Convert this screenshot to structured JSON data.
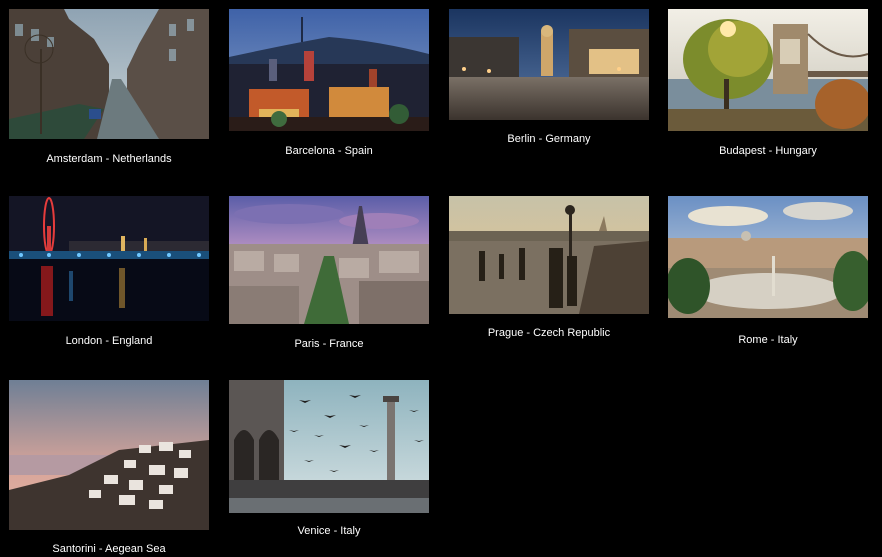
{
  "gallery": {
    "items": [
      {
        "caption": "Amsterdam - Netherlands",
        "image": "amsterdam-canal-photo"
      },
      {
        "caption": "Barcelona - Spain",
        "image": "barcelona-night-skyline-photo"
      },
      {
        "caption": "Berlin - Germany",
        "image": "berlin-square-dusk-photo"
      },
      {
        "caption": "Budapest - Hungary",
        "image": "budapest-chain-bridge-photo"
      },
      {
        "caption": "London - England",
        "image": "london-thames-night-photo"
      },
      {
        "caption": "Paris - France",
        "image": "paris-eiffel-skyline-photo"
      },
      {
        "caption": "Prague - Czech Republic",
        "image": "prague-charles-bridge-photo"
      },
      {
        "caption": "Rome - Italy",
        "image": "rome-piazza-panorama-photo"
      },
      {
        "caption": "Santorini - Aegean Sea",
        "image": "santorini-sunset-photo"
      },
      {
        "caption": "Venice - Italy",
        "image": "venice-pigeons-square-photo"
      }
    ]
  }
}
